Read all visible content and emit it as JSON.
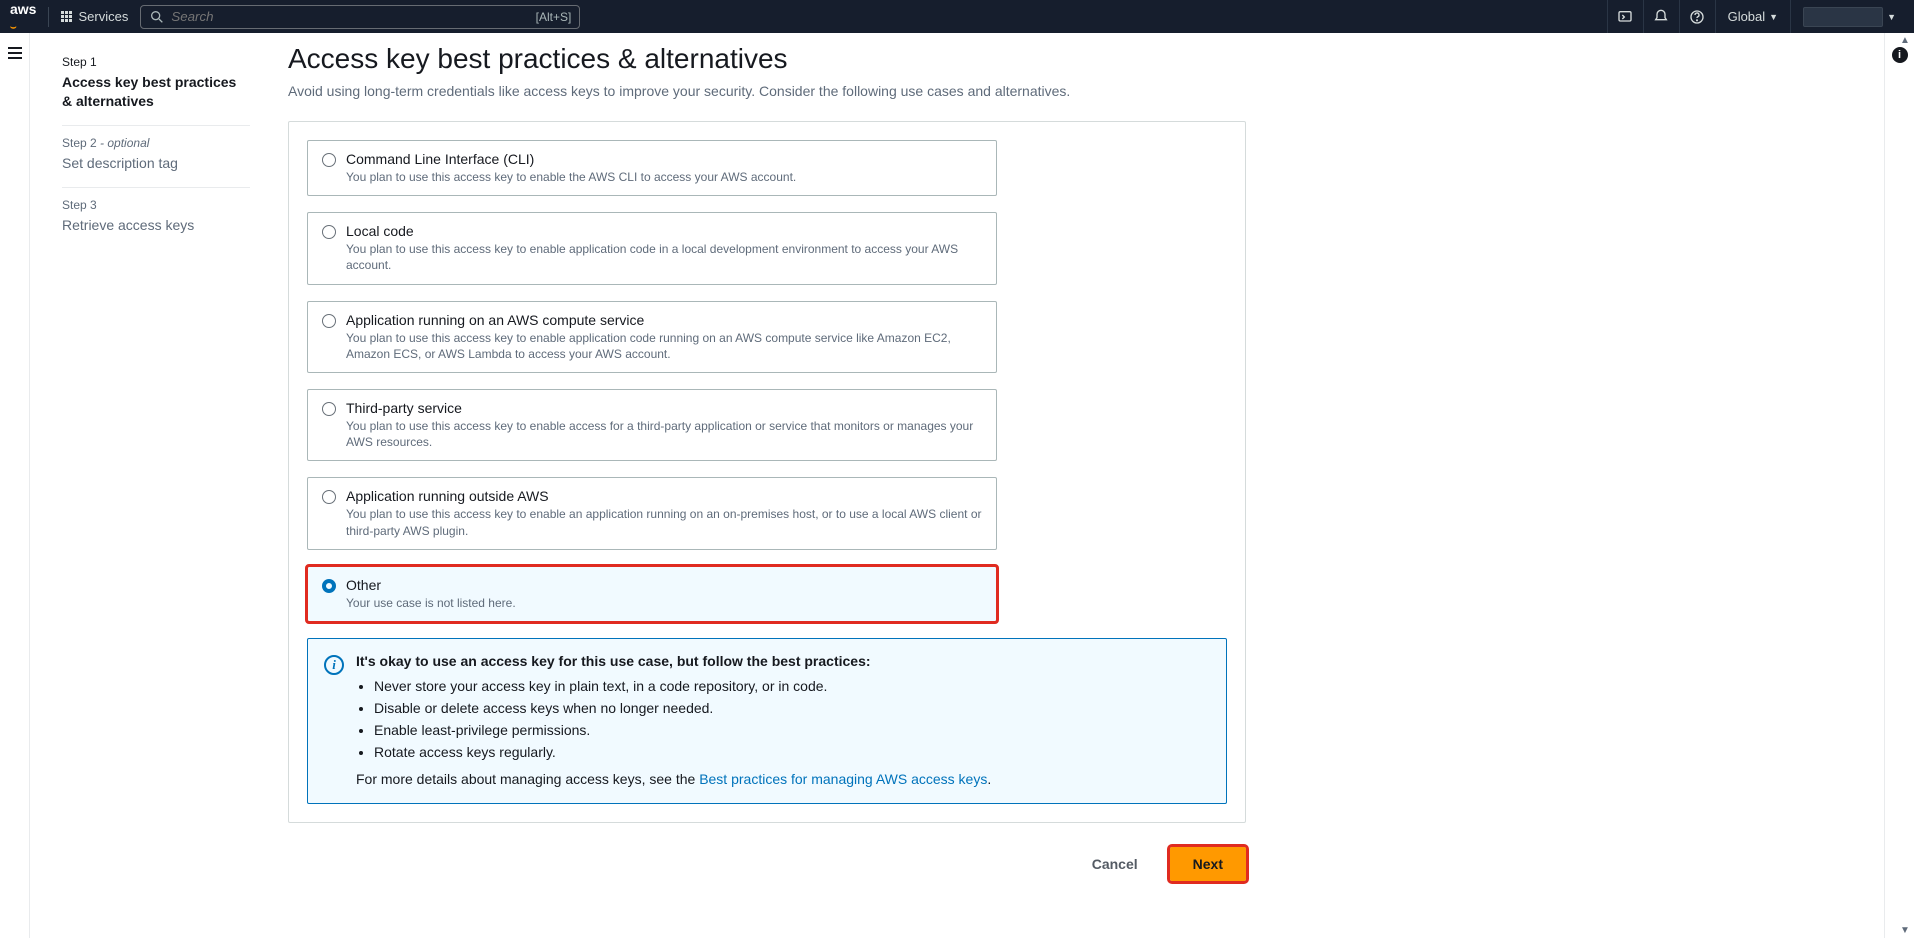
{
  "nav": {
    "logo": "aws",
    "services_label": "Services",
    "search_placeholder": "Search",
    "search_shortcut": "[Alt+S]",
    "region": "Global"
  },
  "steps": [
    {
      "num": "Step 1",
      "optional": "",
      "title": "Access key best practices & alternatives",
      "active": true
    },
    {
      "num": "Step 2",
      "optional": " - optional",
      "title": "Set description tag",
      "active": false
    },
    {
      "num": "Step 3",
      "optional": "",
      "title": "Retrieve access keys",
      "active": false
    }
  ],
  "page": {
    "title": "Access key best practices & alternatives",
    "description": "Avoid using long-term credentials like access keys to improve your security. Consider the following use cases and alternatives."
  },
  "options": [
    {
      "title": "Command Line Interface (CLI)",
      "desc": "You plan to use this access key to enable the AWS CLI to access your AWS account.",
      "selected": false
    },
    {
      "title": "Local code",
      "desc": "You plan to use this access key to enable application code in a local development environment to access your AWS account.",
      "selected": false
    },
    {
      "title": "Application running on an AWS compute service",
      "desc": "You plan to use this access key to enable application code running on an AWS compute service like Amazon EC2, Amazon ECS, or AWS Lambda to access your AWS account.",
      "selected": false
    },
    {
      "title": "Third-party service",
      "desc": "You plan to use this access key to enable access for a third-party application or service that monitors or manages your AWS resources.",
      "selected": false
    },
    {
      "title": "Application running outside AWS",
      "desc": "You plan to use this access key to enable an application running on an on-premises host, or to use a local AWS client or third-party AWS plugin.",
      "selected": false
    },
    {
      "title": "Other",
      "desc": "Your use case is not listed here.",
      "selected": true
    }
  ],
  "info": {
    "title": "It's okay to use an access key for this use case, but follow the best practices:",
    "bullets": [
      "Never store your access key in plain text, in a code repository, or in code.",
      "Disable or delete access keys when no longer needed.",
      "Enable least-privilege permissions.",
      "Rotate access keys regularly."
    ],
    "more_prefix": "For more details about managing access keys, see the ",
    "link_text": "Best practices for managing AWS access keys",
    "more_suffix": "."
  },
  "actions": {
    "cancel": "Cancel",
    "next": "Next"
  }
}
